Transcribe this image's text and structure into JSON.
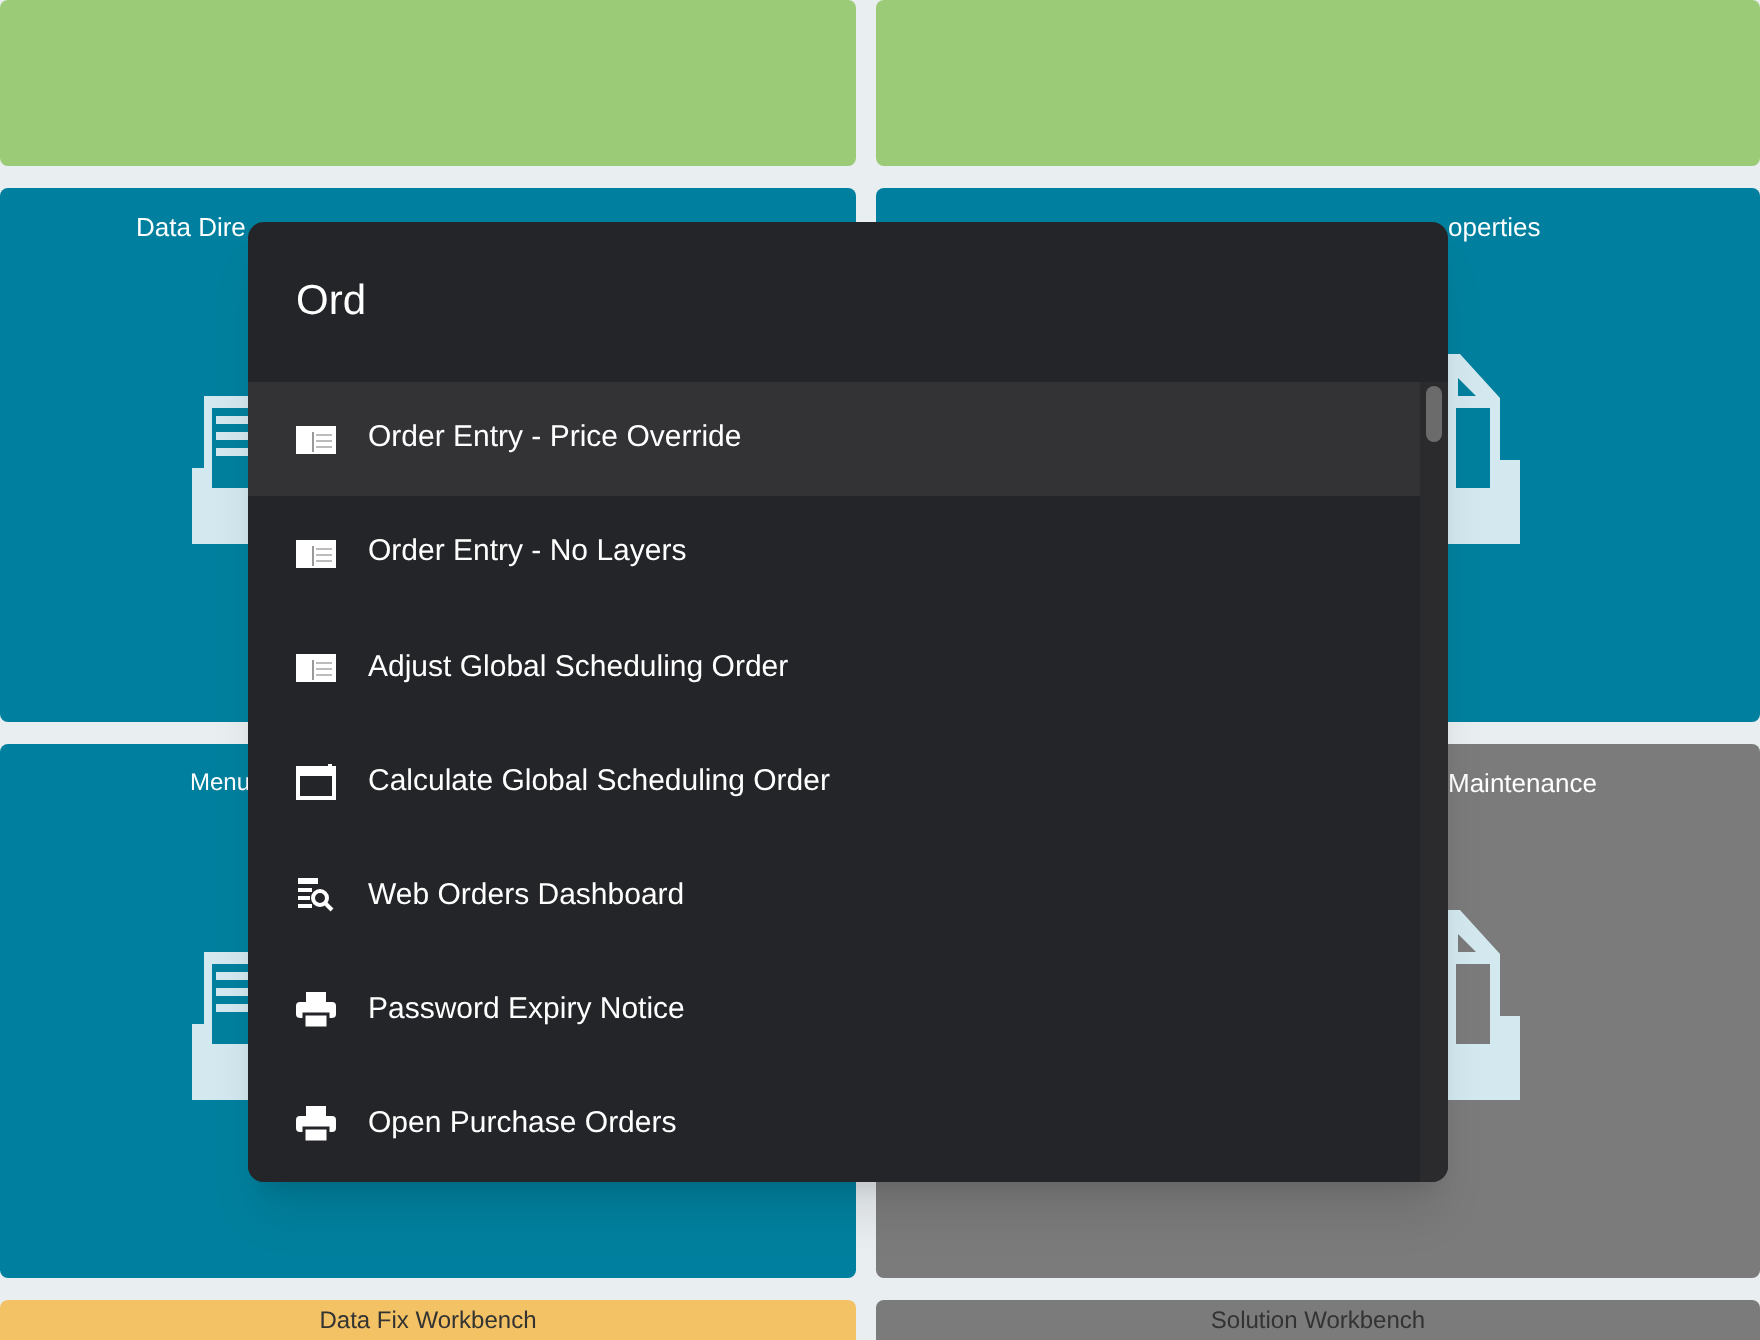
{
  "tiles": [
    {
      "kind": "plain",
      "color": "#9ccb78"
    },
    {
      "kind": "plain",
      "color": "#9ccb78"
    },
    {
      "kind": "left",
      "color": "#00809e",
      "title": "Data Dire"
    },
    {
      "kind": "right",
      "color": "#00809e",
      "title": "operties"
    },
    {
      "kind": "left",
      "color": "#00809e",
      "title": "Menu"
    },
    {
      "kind": "right",
      "color": "#7b7b7b",
      "title": "Maintenance"
    },
    {
      "kind": "bottom",
      "color": "#f2c265",
      "title": "Data Fix Workbench"
    },
    {
      "kind": "bottom",
      "color": "#7b7b7b",
      "title": "Solution Workbench"
    }
  ],
  "search": {
    "value": "Ord"
  },
  "results": [
    {
      "label": "Order Entry - Price Override",
      "kind": "table",
      "selected": true
    },
    {
      "label": "Order Entry - No Layers",
      "kind": "table",
      "selected": false
    },
    {
      "label": "Adjust Global Scheduling Order",
      "kind": "table",
      "selected": false
    },
    {
      "label": "Calculate Global Scheduling Order",
      "kind": "calendar",
      "selected": false
    },
    {
      "label": "Web Orders Dashboard",
      "kind": "report",
      "selected": false
    },
    {
      "label": "Password Expiry Notice",
      "kind": "printer",
      "selected": false
    },
    {
      "label": "Open Purchase Orders",
      "kind": "printer",
      "selected": false
    }
  ]
}
